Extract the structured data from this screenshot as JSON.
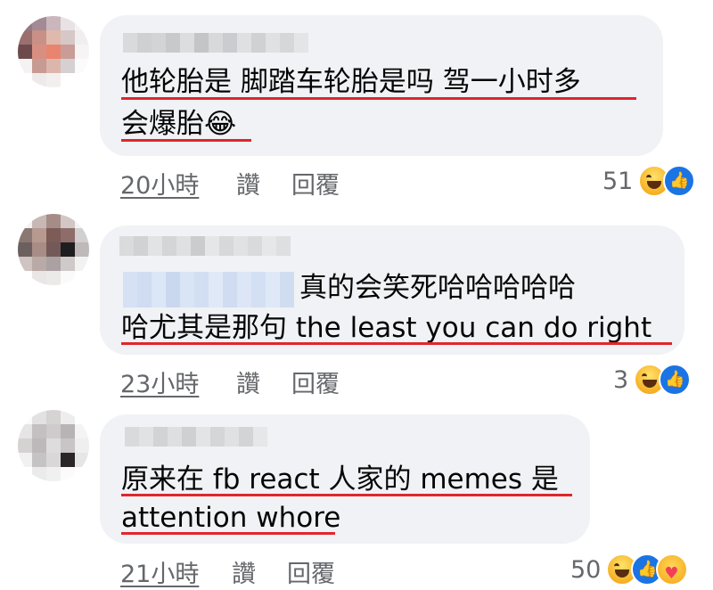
{
  "comments": [
    {
      "lines": [
        "他轮胎是 脚踏车轮胎是吗 驾一小时多",
        "会爆胎😂"
      ],
      "time": "20小時",
      "like_label": "讚",
      "reply_label": "回覆",
      "reaction_count": "51",
      "reactions": [
        "haha-icon",
        "like-icon"
      ]
    },
    {
      "lines": [
        "真的会笑死哈哈哈哈哈",
        "哈尤其是那句 the least you can do right"
      ],
      "time": "23小時",
      "like_label": "讚",
      "reply_label": "回覆",
      "reaction_count": "3",
      "reactions": [
        "haha-icon",
        "like-icon"
      ]
    },
    {
      "lines": [
        "原来在 fb react 人家的 memes 是",
        "attention whore"
      ],
      "time": "21小時",
      "like_label": "讚",
      "reply_label": "回覆",
      "reaction_count": "50",
      "reactions": [
        "haha-icon",
        "like-icon",
        "care-icon"
      ]
    }
  ],
  "colors": {
    "bubble": "#f0f2f5",
    "meta_text": "#65676b",
    "underline_annotation": "#e0262c",
    "like_blue": "#1b74e4"
  }
}
